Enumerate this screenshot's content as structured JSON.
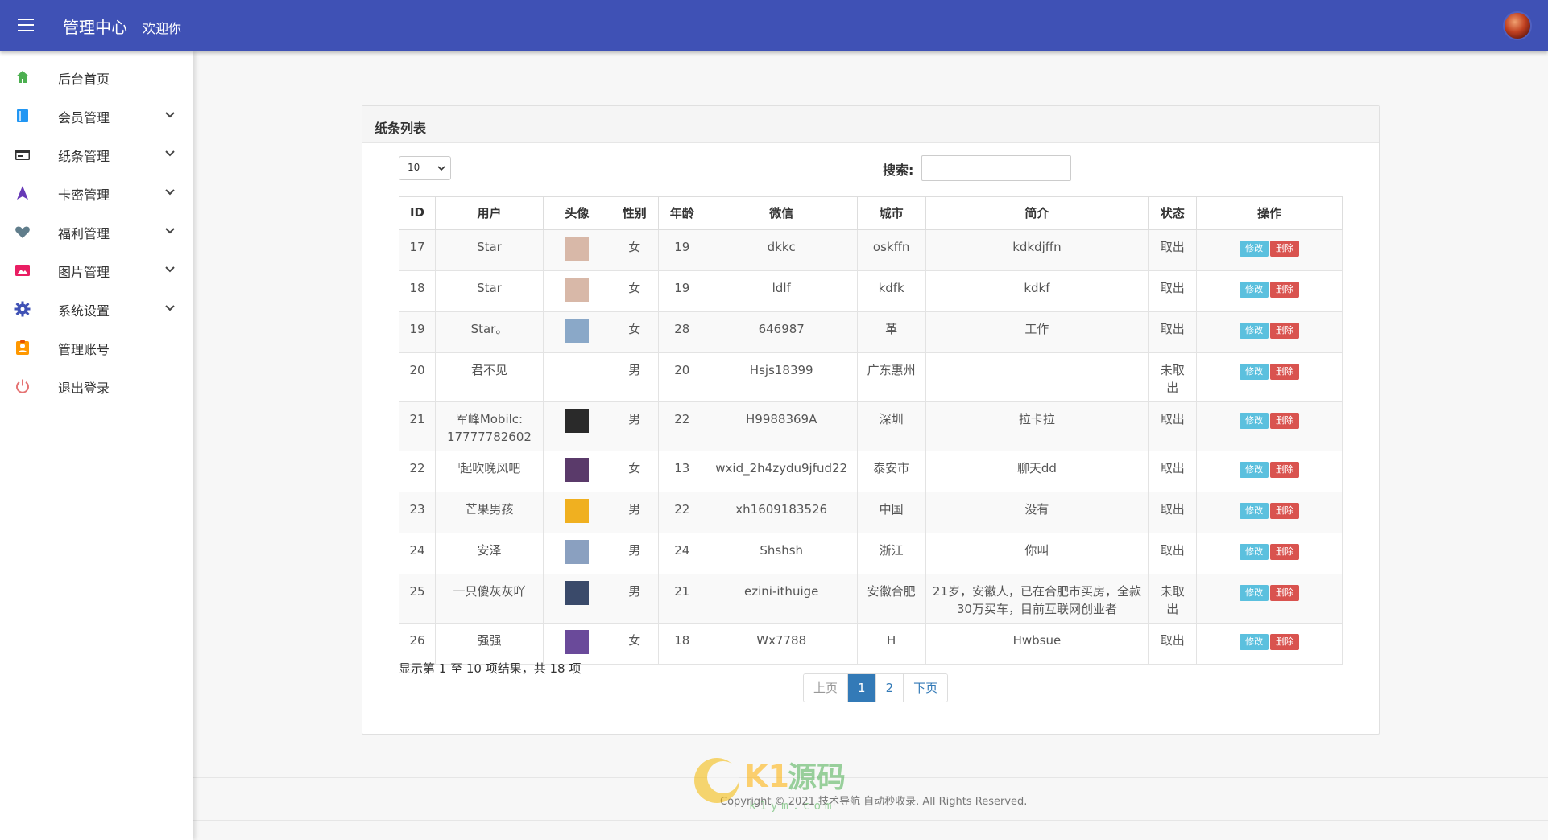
{
  "header": {
    "brand": "管理中心",
    "welcome": "欢迎你"
  },
  "sidebar": {
    "items": [
      {
        "label": "后台首页",
        "icon": "home-icon",
        "color": "#4caf50",
        "expandable": false
      },
      {
        "label": "会员管理",
        "icon": "book-icon",
        "color": "#2196f3",
        "expandable": true
      },
      {
        "label": "纸条管理",
        "icon": "card-icon",
        "color": "#333333",
        "expandable": true
      },
      {
        "label": "卡密管理",
        "icon": "navigation-icon",
        "color": "#673ab7",
        "expandable": true
      },
      {
        "label": "福利管理",
        "icon": "heart-icon",
        "color": "#607d8b",
        "expandable": true
      },
      {
        "label": "图片管理",
        "icon": "image-icon",
        "color": "#e91e63",
        "expandable": true
      },
      {
        "label": "系统设置",
        "icon": "gear-icon",
        "color": "#3f51b5",
        "expandable": true
      },
      {
        "label": "管理账号",
        "icon": "account-icon",
        "color": "#ff9800",
        "expandable": false
      },
      {
        "label": "退出登录",
        "icon": "power-icon",
        "color": "#e57373",
        "expandable": false
      }
    ]
  },
  "panel": {
    "title": "纸条列表"
  },
  "controls": {
    "page_length": "10",
    "search_label": "搜索:",
    "search_value": ""
  },
  "table": {
    "headers": [
      "ID",
      "用户",
      "头像",
      "性别",
      "年龄",
      "微信",
      "城市",
      "简介",
      "状态",
      "操作"
    ],
    "edit_label": "修改",
    "delete_label": "删除",
    "rows": [
      {
        "id": "17",
        "user": "Star",
        "avatar_color": "#d8b8a8",
        "gender": "女",
        "age": "19",
        "wechat": "dkkc",
        "city": "oskffn",
        "intro": "kdkdjffn",
        "status": "取出"
      },
      {
        "id": "18",
        "user": "Star",
        "avatar_color": "#d8b8a8",
        "gender": "女",
        "age": "19",
        "wechat": "ldlf",
        "city": "kdfk",
        "intro": "kdkf",
        "status": "取出"
      },
      {
        "id": "19",
        "user": "Star。",
        "avatar_color": "#8aa8c8",
        "gender": "女",
        "age": "28",
        "wechat": "646987",
        "city": "革",
        "intro": "工作",
        "status": "取出"
      },
      {
        "id": "20",
        "user": "君不见",
        "avatar_color": "#ffffff",
        "gender": "男",
        "age": "20",
        "wechat": "Hsjs18399",
        "city": "广东惠州",
        "intro": "",
        "status": "未取出"
      },
      {
        "id": "21",
        "user": "军峰Mobilc: 17777782602",
        "avatar_color": "#2a2a2a",
        "gender": "男",
        "age": "22",
        "wechat": "H9988369A",
        "city": "深圳",
        "intro": "拉卡拉",
        "status": "取出"
      },
      {
        "id": "22",
        "user": "ˡ起吹晚风吧",
        "avatar_color": "#5a3a6a",
        "gender": "女",
        "age": "13",
        "wechat": "wxid_2h4zydu9jfud22",
        "city": "泰安市",
        "intro": "聊天dd",
        "status": "取出"
      },
      {
        "id": "23",
        "user": "芒果男孩",
        "avatar_color": "#f0b020",
        "gender": "男",
        "age": "22",
        "wechat": "xh1609183526",
        "city": "中国",
        "intro": "没有",
        "status": "取出"
      },
      {
        "id": "24",
        "user": "安泽",
        "avatar_color": "#8aa0c0",
        "gender": "男",
        "age": "24",
        "wechat": "Shshsh",
        "city": "浙江",
        "intro": "你叫",
        "status": "取出"
      },
      {
        "id": "25",
        "user": "一只傻灰灰吖",
        "avatar_color": "#3a4a6a",
        "gender": "男",
        "age": "21",
        "wechat": "ezini-ithuige",
        "city": "安徽合肥",
        "intro": "21岁，安徽人，已在合肥市买房，全款30万买车，目前互联网创业者",
        "status": "未取出"
      },
      {
        "id": "26",
        "user": "强强",
        "avatar_color": "#6a4a9a",
        "gender": "女",
        "age": "18",
        "wechat": "Wx7788",
        "city": "H",
        "intro": "Hwbsue",
        "status": "取出"
      }
    ]
  },
  "summary": "显示第 1 至 10 项结果，共 18 项",
  "pagination": {
    "prev": "上页",
    "pages": [
      "1",
      "2"
    ],
    "current": "1",
    "next": "下页"
  },
  "footer": {
    "text": "Copyright © 2021 技术导航 自动秒收录. All Rights Reserved."
  },
  "watermark": {
    "text": "K1源码",
    "sub": "k1ym.com"
  }
}
